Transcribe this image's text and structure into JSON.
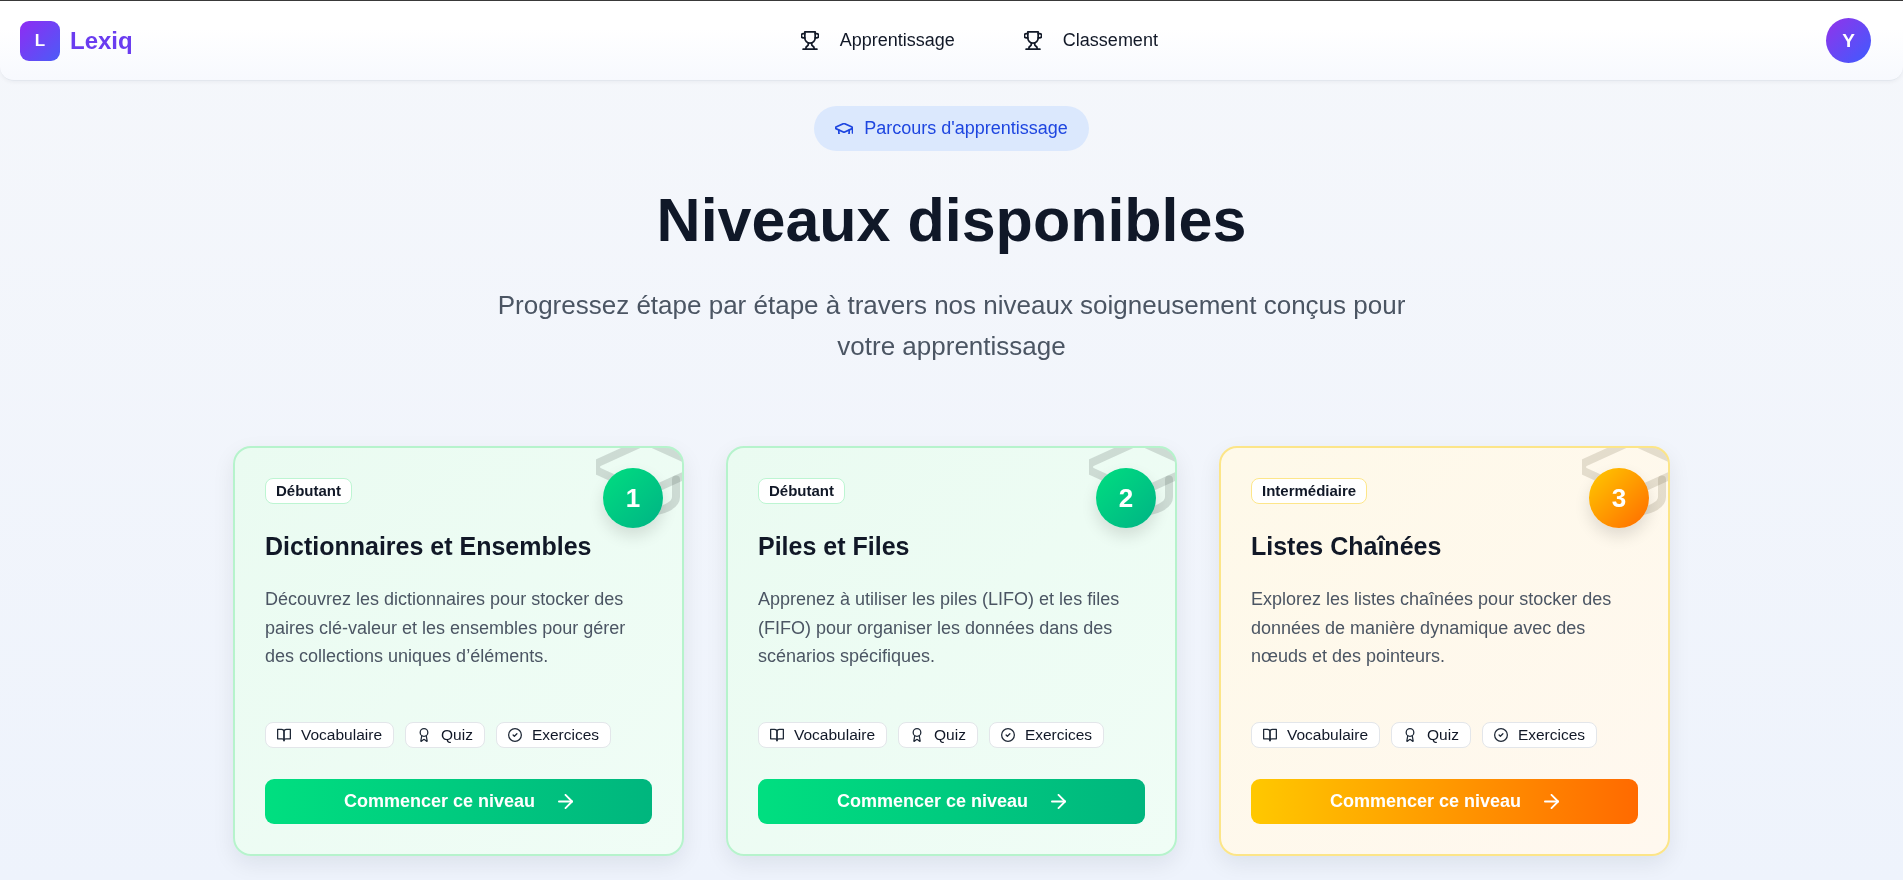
{
  "header": {
    "logo": {
      "letter": "L",
      "name": "Lexiq"
    },
    "nav": [
      {
        "label": "Apprentissage"
      },
      {
        "label": "Classement"
      }
    ],
    "avatar": "Y"
  },
  "hero": {
    "badge": "Parcours d'apprentissage",
    "title": "Niveaux disponibles",
    "subtitle": "Progressez étape par étape à travers nos niveaux soigneusement conçus pour votre apprentissage"
  },
  "levels": [
    {
      "kind": "beginner",
      "difficulty": "Débutant",
      "number": "1",
      "title": "Dictionnaires et Ensembles",
      "description": "Découvrez les dictionnaires pour stocker des paires clé-valeur et les ensembles pour gérer des collections uniques d’éléments.",
      "features": [
        {
          "kind": "vocabulary",
          "label": "Vocabulaire"
        },
        {
          "kind": "quiz",
          "label": "Quiz"
        },
        {
          "kind": "exercises",
          "label": "Exercices"
        }
      ],
      "button": "Commencer ce niveau"
    },
    {
      "kind": "beginner",
      "difficulty": "Débutant",
      "number": "2",
      "title": "Piles et Files",
      "description": "Apprenez à utiliser les piles (LIFO) et les files (FIFO) pour organiser les données dans des scénarios spécifiques.",
      "features": [
        {
          "kind": "vocabulary",
          "label": "Vocabulaire"
        },
        {
          "kind": "quiz",
          "label": "Quiz"
        },
        {
          "kind": "exercises",
          "label": "Exercices"
        }
      ],
      "button": "Commencer ce niveau"
    },
    {
      "kind": "intermediate",
      "difficulty": "Intermédiaire",
      "number": "3",
      "title": "Listes Chaînées",
      "description": "Explorez les listes chaînées pour stocker des données de manière dynamique avec des nœuds et des pointeurs.",
      "features": [
        {
          "kind": "vocabulary",
          "label": "Vocabulaire"
        },
        {
          "kind": "quiz",
          "label": "Quiz"
        },
        {
          "kind": "exercises",
          "label": "Exercices"
        }
      ],
      "button": "Commencer ce niveau"
    }
  ]
}
